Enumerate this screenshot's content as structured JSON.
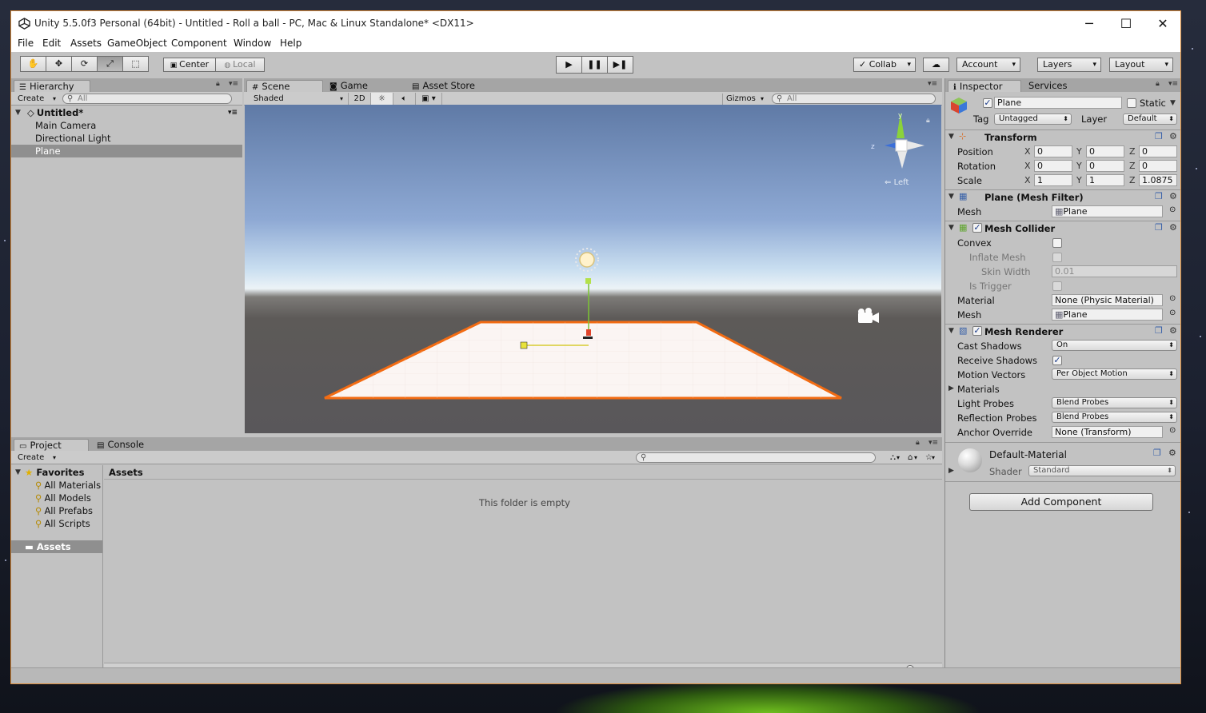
{
  "window": {
    "title": "Unity 5.5.0f3 Personal (64bit) - Untitled - Roll a ball - PC, Mac & Linux Standalone* <DX11>"
  },
  "menu": [
    "File",
    "Edit",
    "Assets",
    "GameObject",
    "Component",
    "Window",
    "Help"
  ],
  "toolbar": {
    "center_label": "Center",
    "local_label": "Local",
    "collab_label": "Collab",
    "account_label": "Account",
    "layers_label": "Layers",
    "layout_label": "Layout"
  },
  "hierarchy": {
    "tab_label": "Hierarchy",
    "create_label": "Create",
    "search_placeholder": "All",
    "scene_name": "Untitled*",
    "items": [
      {
        "label": "Main Camera"
      },
      {
        "label": "Directional Light"
      },
      {
        "label": "Plane",
        "selected": true
      }
    ]
  },
  "scene": {
    "tabs": [
      "Scene",
      "Game",
      "Asset Store"
    ],
    "shading_mode": "Shaded",
    "mode_2d_label": "2D",
    "gizmos_label": "Gizmos",
    "search_placeholder": "All",
    "view_label": "Left"
  },
  "inspector": {
    "tabs": [
      "Inspector",
      "Services"
    ],
    "object_name": "Plane",
    "static_label": "Static",
    "tag_label": "Tag",
    "tag_value": "Untagged",
    "layer_label": "Layer",
    "layer_value": "Default",
    "transform": {
      "title": "Transform",
      "position_label": "Position",
      "rotation_label": "Rotation",
      "scale_label": "Scale",
      "position": [
        "0",
        "0",
        "0"
      ],
      "rotation": [
        "0",
        "0",
        "0"
      ],
      "scale": [
        "1",
        "1",
        "1.0875"
      ]
    },
    "mesh_filter": {
      "title": "Plane (Mesh Filter)",
      "mesh_label": "Mesh",
      "mesh_value": "Plane"
    },
    "mesh_collider": {
      "title": "Mesh Collider",
      "convex_label": "Convex",
      "inflate_label": "Inflate Mesh",
      "skin_label": "Skin Width",
      "skin_value": "0.01",
      "trigger_label": "Is Trigger",
      "material_label": "Material",
      "material_value": "None (Physic Material)",
      "mesh_label": "Mesh",
      "mesh_value": "Plane"
    },
    "mesh_renderer": {
      "title": "Mesh Renderer",
      "cast_label": "Cast Shadows",
      "cast_value": "On",
      "receive_label": "Receive Shadows",
      "motion_label": "Motion Vectors",
      "motion_value": "Per Object Motion",
      "materials_label": "Materials",
      "light_label": "Light Probes",
      "light_value": "Blend Probes",
      "reflection_label": "Reflection Probes",
      "reflection_value": "Blend Probes",
      "anchor_label": "Anchor Override",
      "anchor_value": "None (Transform)"
    },
    "material": {
      "name": "Default-Material",
      "shader_label": "Shader",
      "shader_value": "Standard"
    },
    "add_component_label": "Add Component"
  },
  "project": {
    "tabs": [
      "Project",
      "Console"
    ],
    "create_label": "Create",
    "favorites_label": "Favorites",
    "favorites": [
      "All Materials",
      "All Models",
      "All Prefabs",
      "All Scripts"
    ],
    "assets_label": "Assets",
    "breadcrumb": "Assets",
    "empty_text": "This folder is empty"
  },
  "colors": {
    "selection_outline": "#f26b12",
    "editor_bg": "#c2c2c2",
    "window_border": "#d98b3a"
  }
}
